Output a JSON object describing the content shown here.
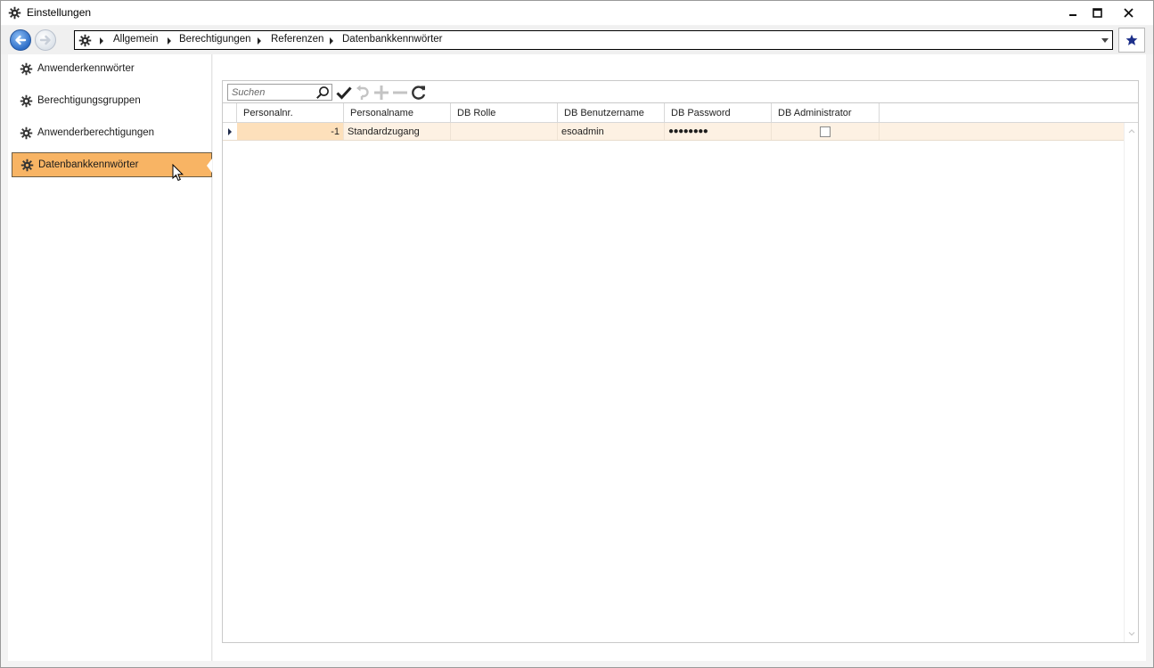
{
  "window": {
    "title": "Einstellungen",
    "icon": "gear-icon",
    "controls": [
      "minimize",
      "maximize",
      "close"
    ]
  },
  "navbar": {
    "breadcrumb": [
      "Allgemein",
      "Berechtigungen",
      "Referenzen",
      "Datenbankkennwörter"
    ],
    "favorite_icon": "star-icon"
  },
  "sidebar": {
    "items": [
      {
        "label": "Anwenderkennwörter",
        "active": false
      },
      {
        "label": "Berechtigungsgruppen",
        "active": false
      },
      {
        "label": "Anwenderberechtigungen",
        "active": false
      },
      {
        "label": "Datenbankkennwörter",
        "active": true
      }
    ],
    "active_color": "#f8b464"
  },
  "toolbar": {
    "search_placeholder": "Suchen",
    "search_value": "",
    "buttons": [
      "check-icon",
      "undo-icon",
      "add-icon",
      "remove-icon",
      "refresh-icon"
    ]
  },
  "grid": {
    "columns": [
      "Personalnr.",
      "Personalname",
      "DB Rolle",
      "DB Benutzername",
      "DB Password",
      "DB Administrator"
    ],
    "rows": [
      {
        "personalnr": "-1",
        "personalname": "Standardzugang",
        "db_rolle": "",
        "db_benutzername": "esoadmin",
        "db_password": "●●●●●●●●",
        "db_administrator": false
      }
    ],
    "row_highlight_color": "#fdf1e3"
  }
}
